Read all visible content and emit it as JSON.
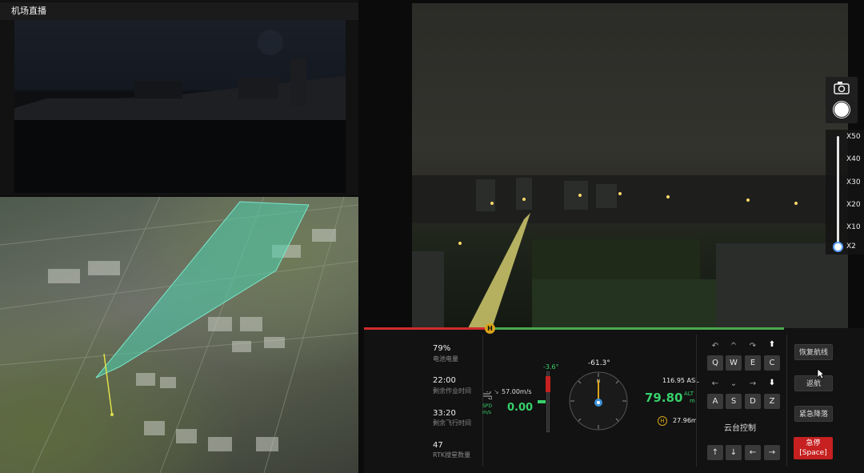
{
  "dock": {
    "title": "机场直播"
  },
  "zoom": {
    "levels": [
      "X50",
      "X40",
      "X30",
      "X20",
      "X10",
      "X2"
    ]
  },
  "stats": [
    {
      "value": "79%",
      "label": "电池电量"
    },
    {
      "value": "22:00",
      "label": "剩余作业时间"
    },
    {
      "value": "33:20",
      "label": "剩余飞行时间"
    },
    {
      "value": "47",
      "label": "RTK搜星数量"
    }
  ],
  "speed": {
    "label_top": "SPD",
    "label_bottom": "m/s",
    "value": "0.00",
    "wind": "57.00m/s"
  },
  "gimbal": {
    "pitch": "-3.6°"
  },
  "heading": {
    "value": "-61.3°"
  },
  "altitude": {
    "asl": "116.95 ASL",
    "alt": "79.80",
    "alt_label_top": "ALT",
    "alt_label_bottom": "m",
    "home_distance": "27.96m"
  },
  "keypad": {
    "row1": [
      "Q",
      "W",
      "E",
      "C"
    ],
    "row2": [
      "A",
      "S",
      "D",
      "Z"
    ],
    "title": "云台控制"
  },
  "buttons": {
    "resume": "恢复航线",
    "return": "返航",
    "emergency": "紧急降落",
    "stop_line1": "急停",
    "stop_line2": "[Space]"
  },
  "colors": {
    "accent_green": "#37d06a",
    "danger_red": "#c62020",
    "track_teal": "#4fd1b0"
  },
  "progress": {
    "fraction": 0.3
  }
}
